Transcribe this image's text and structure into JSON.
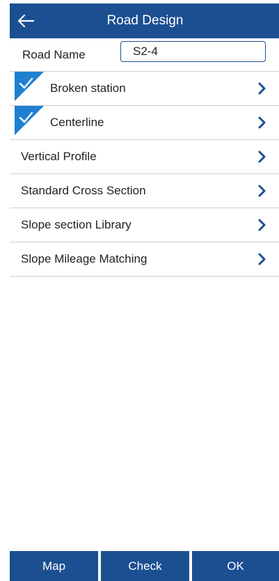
{
  "header": {
    "title": "Road Design",
    "back_icon": "arrow-left-icon"
  },
  "road_name": {
    "label": "Road Name",
    "value": "S2-4"
  },
  "menu": {
    "items": [
      {
        "label": "Broken station",
        "checked": true
      },
      {
        "label": "Centerline",
        "checked": true
      },
      {
        "label": "Vertical Profile",
        "checked": false
      },
      {
        "label": "Standard Cross Section",
        "checked": false
      },
      {
        "label": "Slope section Library",
        "checked": false
      },
      {
        "label": "Slope Mileage Matching",
        "checked": false
      }
    ],
    "chevron_icon": "chevron-right-icon",
    "check_icon": "checkmark-icon"
  },
  "footer": {
    "map_label": "Map",
    "check_label": "Check",
    "ok_label": "OK"
  },
  "colors": {
    "primary": "#1c4f91",
    "check_badge": "#1f80d1",
    "divider": "#cfcfcf",
    "text": "#222222"
  }
}
